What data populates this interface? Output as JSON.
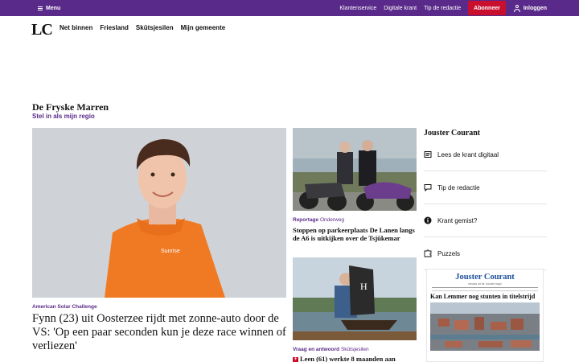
{
  "topbar": {
    "menu_label": "Menu",
    "links": [
      "Klantenservice",
      "Digitale krant",
      "Tip de redactie"
    ],
    "subscribe_label": "Abonneer",
    "login_label": "Inloggen",
    "bg_color": "#5a2a8a",
    "subscribe_color": "#c8102e"
  },
  "logo": "LC",
  "nav": [
    "Net binnen",
    "Friesland",
    "Skûtsjesilen",
    "Mijn gemeente"
  ],
  "region": {
    "title": "De Fryske Marren",
    "link": "Stel in als mijn regio"
  },
  "lead": {
    "kicker": "American Solar Challenge",
    "title": "Fynn (23) uit Oosterzee rijdt met zonne-auto door de VS: 'Op een paar seconden kun je deze race winnen of verliezen'",
    "shirt_text": "Sunrise"
  },
  "articles": [
    {
      "kicker": "Reportage",
      "subkicker": "Onderweg",
      "title": "Stoppen op parkeerplaats De Lanen langs de A6 is uitkijken over de Tsjûkemar"
    },
    {
      "kicker": "Vraag en antwoord",
      "subkicker": "Skûtsjesilen",
      "plus": "+",
      "title": "Leen (61) werkte 8 maanden aan"
    }
  ],
  "sidebar": {
    "title": "Jouster Courant",
    "items": [
      {
        "label": "Lees de krant digitaal",
        "icon": "newspaper-icon"
      },
      {
        "label": "Tip de redactie",
        "icon": "chat-icon"
      },
      {
        "label": "Krant gemist?",
        "icon": "info-icon"
      },
      {
        "label": "Puzzels",
        "icon": "puzzle-icon"
      }
    ],
    "paper": {
      "masthead": "Jouster Courant",
      "subline": "nieuws uit de Jouster regio",
      "headline": "Kan Lemmer nog stunten in titelstrijd"
    }
  }
}
